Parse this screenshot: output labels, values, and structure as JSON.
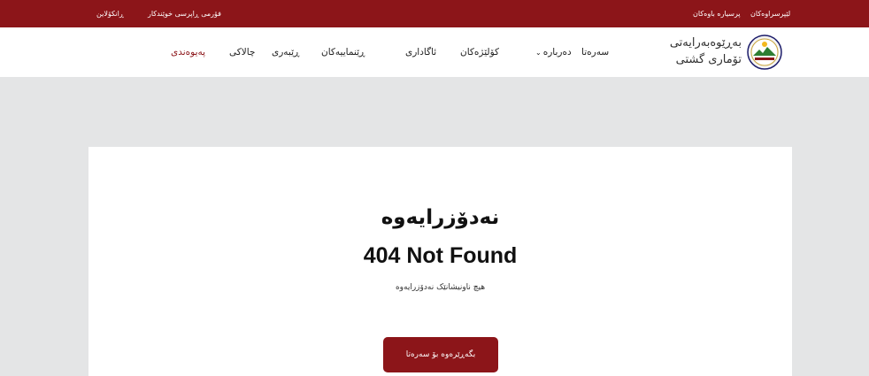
{
  "topbar": {
    "links_right": [
      "لێپرسراوەکان",
      "پرسیارە باوەکان"
    ],
    "links_left": [
      "فۆرمی ڕاپرسی خوێندکار",
      "ڕانکۆلاین"
    ]
  },
  "header": {
    "brand_line1": "بەڕێوەبەرایەتی",
    "brand_line2": "تۆماری گشتی",
    "menu": [
      "سەرەتا",
      "دەربارە",
      "کۆلێژەکان",
      "ئاگاداری",
      "ڕێنماییەکان",
      "ڕێبەری",
      "چالاکی",
      "پەیوەندی"
    ]
  },
  "notfound": {
    "heading_ku": "نەدۆزرایەوە",
    "heading_en": "404 Not Found",
    "message": "هیچ ناونیشانێک نەدۆزرایەوە",
    "button": "بگەڕێرەوە بۆ سەرەتا"
  },
  "colors": {
    "brand": "#8c1519",
    "background": "#e4e5e6"
  }
}
